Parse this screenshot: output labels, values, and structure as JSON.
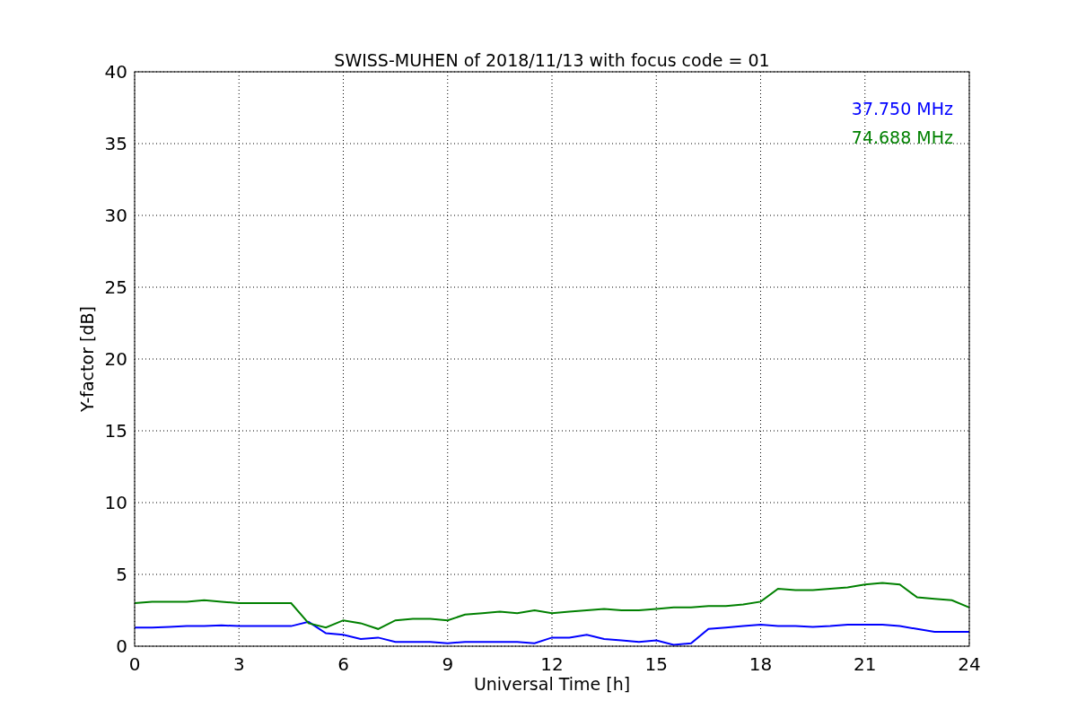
{
  "chart_data": {
    "type": "line",
    "title": "SWISS-MUHEN of 2018/11/13 with focus code = 01",
    "xlabel": "Universal Time [h]",
    "ylabel": "Y-factor [dB]",
    "x": [
      0,
      0.5,
      1,
      1.5,
      2,
      2.5,
      3,
      3.5,
      4,
      4.5,
      5,
      5.5,
      6,
      6.5,
      7,
      7.5,
      8,
      8.5,
      9,
      9.5,
      10,
      10.5,
      11,
      11.5,
      12,
      12.5,
      13,
      13.5,
      14,
      14.5,
      15,
      15.5,
      16,
      16.5,
      17,
      17.5,
      18,
      18.5,
      19,
      19.5,
      20,
      20.5,
      21,
      21.5,
      22,
      22.5,
      23,
      23.5,
      24
    ],
    "series": [
      {
        "name": "37.750 MHz",
        "color": "#0000ff",
        "values": [
          1.3,
          1.3,
          1.35,
          1.4,
          1.4,
          1.45,
          1.4,
          1.4,
          1.4,
          1.4,
          1.7,
          0.9,
          0.8,
          0.5,
          0.6,
          0.3,
          0.3,
          0.3,
          0.2,
          0.3,
          0.3,
          0.3,
          0.3,
          0.2,
          0.6,
          0.6,
          0.8,
          0.5,
          0.4,
          0.3,
          0.4,
          0.1,
          0.2,
          1.2,
          1.3,
          1.4,
          1.5,
          1.4,
          1.4,
          1.35,
          1.4,
          1.5,
          1.5,
          1.5,
          1.4,
          1.2,
          1.0,
          1.0,
          1.0
        ]
      },
      {
        "name": "74.688 MHz",
        "color": "#008000",
        "values": [
          3.0,
          3.1,
          3.1,
          3.1,
          3.2,
          3.1,
          3.0,
          3.0,
          3.0,
          3.0,
          1.6,
          1.3,
          1.8,
          1.6,
          1.2,
          1.8,
          1.9,
          1.9,
          1.8,
          2.2,
          2.3,
          2.4,
          2.3,
          2.5,
          2.3,
          2.4,
          2.5,
          2.6,
          2.5,
          2.5,
          2.6,
          2.7,
          2.7,
          2.8,
          2.8,
          2.9,
          3.1,
          4.0,
          3.9,
          3.9,
          4.0,
          4.1,
          4.3,
          4.4,
          4.3,
          3.4,
          3.3,
          3.2,
          2.7
        ]
      }
    ],
    "xlim": [
      0,
      24
    ],
    "ylim": [
      0,
      40
    ],
    "xticks": [
      0,
      3,
      6,
      9,
      12,
      15,
      18,
      21,
      24
    ],
    "yticks": [
      0,
      5,
      10,
      15,
      20,
      25,
      30,
      35,
      40
    ],
    "grid": true
  }
}
